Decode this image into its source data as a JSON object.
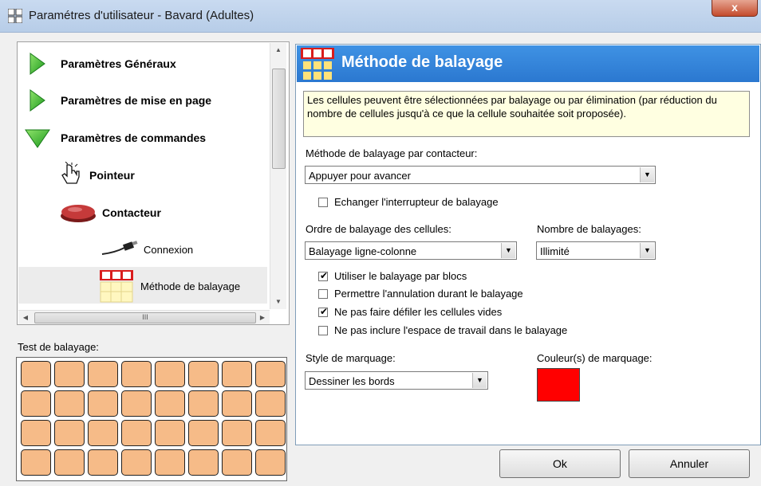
{
  "window": {
    "title": "Paramétres d'utilisateur - Bavard (Adultes)",
    "close_label": "x"
  },
  "tree": {
    "items": [
      {
        "label": "Paramètres Généraux",
        "icon": "play-icon"
      },
      {
        "label": "Paramètres de mise en page",
        "icon": "play-icon"
      },
      {
        "label": "Paramètres de commandes",
        "icon": "expanded-triangle-icon"
      },
      {
        "label": "Pointeur",
        "icon": "hand-pointer-icon"
      },
      {
        "label": "Contacteur",
        "icon": "switch-button-icon"
      },
      {
        "label": "Connexion",
        "icon": "cable-plug-icon"
      },
      {
        "label": "Méthode de balayage",
        "icon": "scan-grid-icon"
      }
    ],
    "hscroll_glyph": "III"
  },
  "test": {
    "label": "Test de balayage:",
    "rows": 4,
    "cols": 8,
    "cell_color": "#f6bb88"
  },
  "panel": {
    "title": "Méthode de balayage",
    "header_color": "#2b78d0",
    "description": "Les cellules peuvent être sélectionnées par balayage ou par élimination (par réduction du nombre de cellules jusqu'à ce que la cellule souhaitée soit proposée).",
    "method_label": "Méthode de balayage par contacteur:",
    "method_value": "Appuyer pour avancer",
    "swap_label": "Echanger l'interrupteur de balayage",
    "swap_checked": false,
    "order_label": "Ordre de balayage des cellules:",
    "order_value": "Balayage ligne-colonne",
    "count_label": "Nombre de balayages:",
    "count_value": "Illimité",
    "options": [
      {
        "label": "Utiliser le balayage par blocs",
        "checked": true
      },
      {
        "label": "Permettre l'annulation durant le balayage",
        "checked": false
      },
      {
        "label": "Ne pas faire défiler les cellules vides",
        "checked": true
      },
      {
        "label": "Ne pas inclure l'espace de travail dans le balayage",
        "checked": false
      }
    ],
    "style_label": "Style de marquage:",
    "style_value": "Dessiner les bords",
    "color_label": "Couleur(s) de marquage:",
    "marking_color": "#ff0000"
  },
  "buttons": {
    "ok": "Ok",
    "cancel": "Annuler"
  }
}
